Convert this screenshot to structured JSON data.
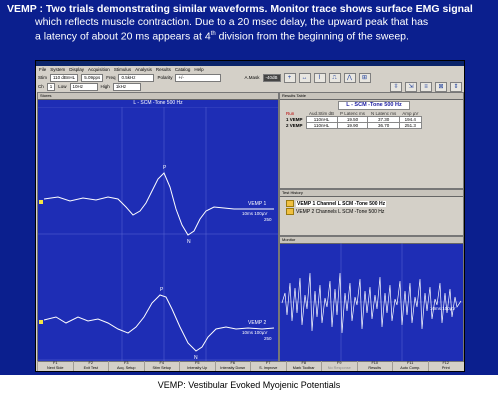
{
  "slide": {
    "line1": "VEMP : Two trials demonstrating similar waveforms. Monitor trace shows surface EMG signal",
    "line2": "which reflects muscle contraction. Due to a 20 msec delay, the upward peak that has",
    "line3a": "a latency of about 20 ms appears at 4",
    "line3sup": "th",
    "line3b": " division from the beginning of the sweep.",
    "caption": "VEMP: Vestibular Evoked Myojenic Potentials"
  },
  "app": {
    "menu": [
      "File",
      "System",
      "Display",
      "Acquisition",
      "Stimulus",
      "Analysis",
      "Results",
      "Catalog",
      "Help"
    ],
    "controls1": {
      "stim_label": "Stim",
      "stim_value": "110 dBnHL",
      "rate_value": "5.09pps",
      "freq_label": "Freq",
      "freq_value": "0.5kHz",
      "polarity_label": "Polarity",
      "polarity_value": "+/-",
      "amask_label": "A.Mask",
      "amask_value": "-40dB"
    },
    "controls2": {
      "ch_label": "Ch",
      "ch_value": "1",
      "low_label": "Low",
      "low_value": "10Hz",
      "high_label": "High",
      "high_value": "1kHz"
    },
    "toolbar_icons": [
      "+",
      "↔",
      "⌇",
      "⎍",
      "⋀",
      "⊞",
      "⇳",
      "⇲",
      "≡",
      "⊠",
      "⇕"
    ],
    "traces": {
      "panel_label": "Stores",
      "caption": "L - SCM -Tone 500 Hz",
      "t1": {
        "p": "P",
        "n": "N",
        "label": "VEMP 1",
        "scale1": "10ms 100µV",
        "scale2": "250"
      },
      "t2": {
        "p": "P",
        "n": "N",
        "label": "VEMP 2",
        "scale1": "10ms 100µV",
        "scale2": "250"
      }
    },
    "results": {
      "panel_label": "Results Table",
      "title": "L - SCM -Tone 500 Hz",
      "headers": [
        "Run",
        "Aud.Stim dB",
        "P Latenc ms",
        "N Latenc ms",
        "Amp µV"
      ],
      "rows": [
        [
          "1 VEMP",
          "110nHL",
          "19.50",
          "37.30",
          "194.4"
        ],
        [
          "2 VEMP",
          "110nHL",
          "19.90",
          "36.70",
          "251.3"
        ]
      ]
    },
    "history": {
      "panel_label": "Test History",
      "items": [
        "VEMP 1 Channel L SCM -Tone 500 Hz",
        "VEMP 2 Channels L SCM -Tone 500 Hz"
      ]
    },
    "monitor": {
      "panel_label": "Monitor",
      "scale": "10ms 100µV"
    },
    "fkeys": [
      {
        "key": "F1",
        "label": "Next Side"
      },
      {
        "key": "F2",
        "label": "Exit Test"
      },
      {
        "key": "F3",
        "label": "Acq. Setup"
      },
      {
        "key": "F4",
        "label": "Stim Setup"
      },
      {
        "key": "F5",
        "label": "Intensity Up"
      },
      {
        "key": "F6",
        "label": "Intensity Down"
      },
      {
        "key": "F7",
        "label": "S. Improve"
      },
      {
        "key": "F8",
        "label": "Mark Toolbar"
      },
      {
        "key": "F9",
        "label": "No Response"
      },
      {
        "key": "F10",
        "label": "Results"
      },
      {
        "key": "F11",
        "label": "Auto Comp."
      },
      {
        "key": "F12",
        "label": "Print"
      }
    ]
  },
  "colors": {
    "slide_bg": "#0b1f8e",
    "trace_bg": "#1e2db5",
    "trace_line": "#ffffff",
    "marker": "#f5e642"
  }
}
